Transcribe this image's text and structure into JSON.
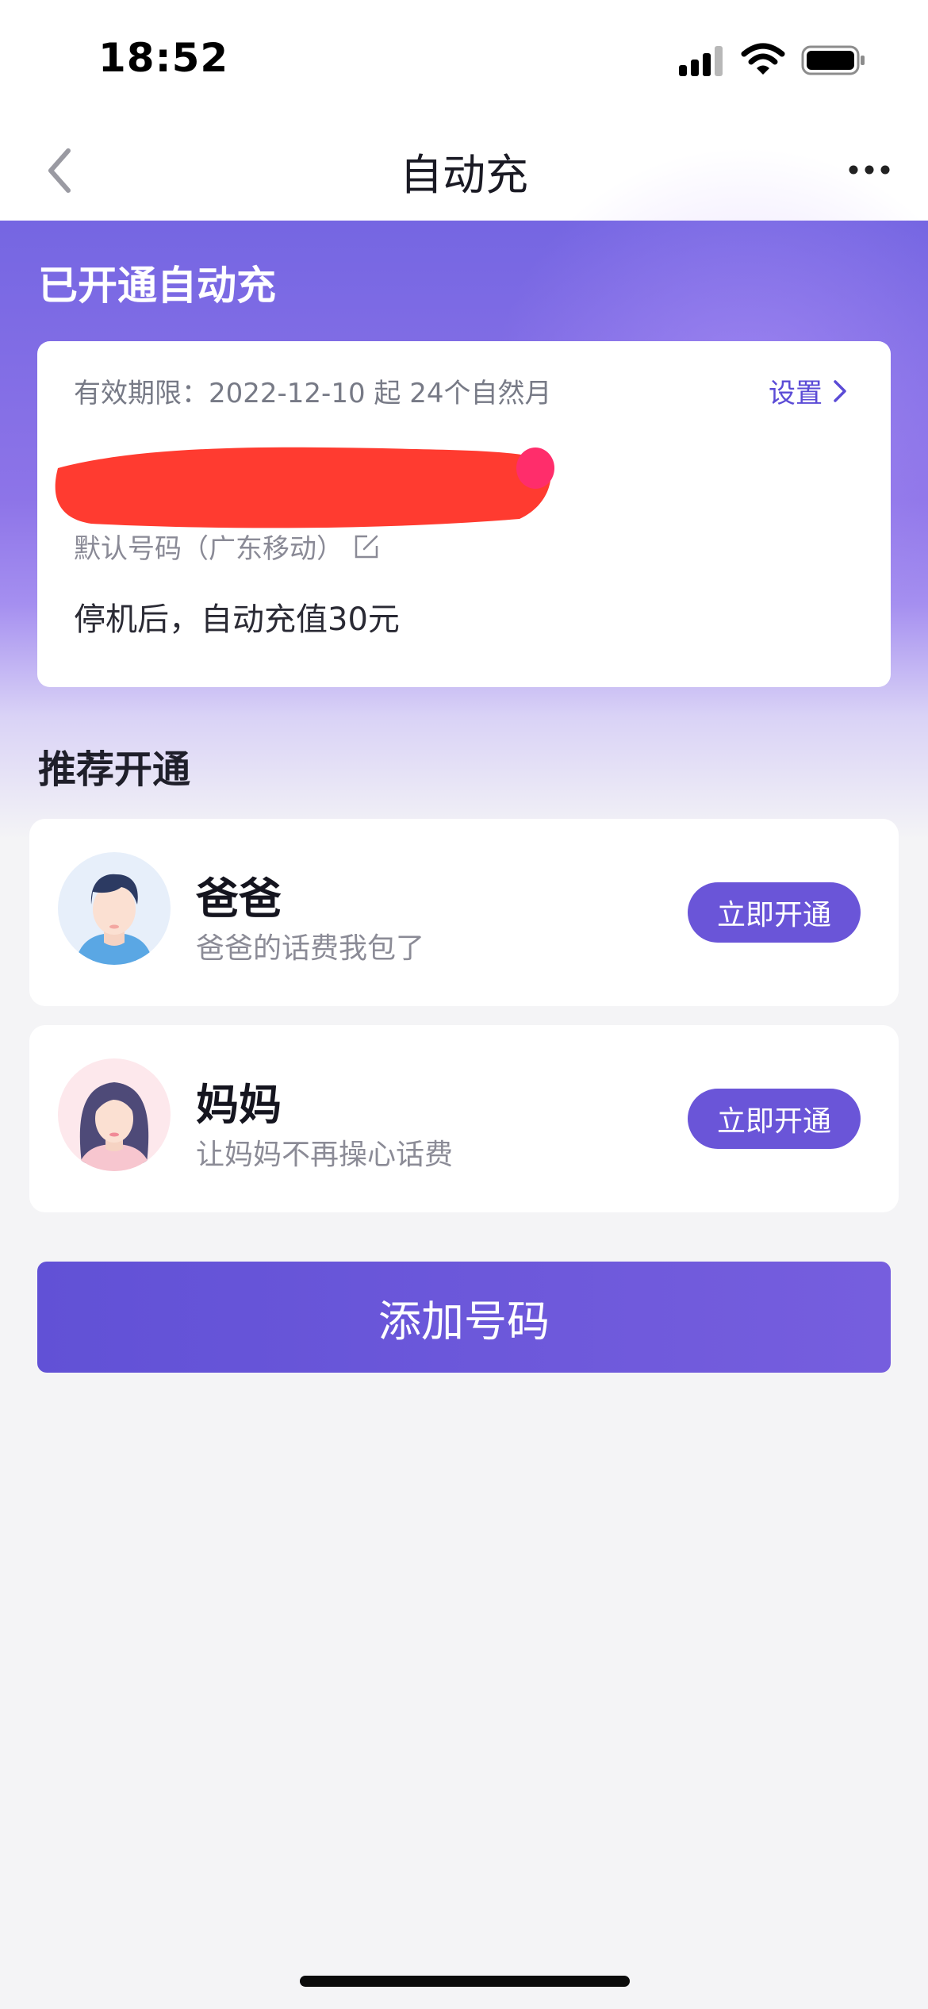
{
  "status_bar": {
    "time": "18:52"
  },
  "nav": {
    "title": "自动充"
  },
  "active_section": {
    "title": "已开通自动充",
    "card": {
      "validity": "有效期限：2022-12-10 起 24个自然月",
      "settings_label": "设置",
      "number_type": "默认号码（广东移动）",
      "rule": "停机后，自动充值30元"
    }
  },
  "recommend_section": {
    "title": "推荐开通",
    "items": [
      {
        "name": "爸爸",
        "desc": "爸爸的话费我包了",
        "button": "立即开通"
      },
      {
        "name": "妈妈",
        "desc": "让妈妈不再操心话费",
        "button": "立即开通"
      }
    ]
  },
  "add_button_label": "添加号码",
  "colors": {
    "accent": "#6a55d8",
    "gradient_start": "#7566e2",
    "redaction": "#ff3b30"
  }
}
